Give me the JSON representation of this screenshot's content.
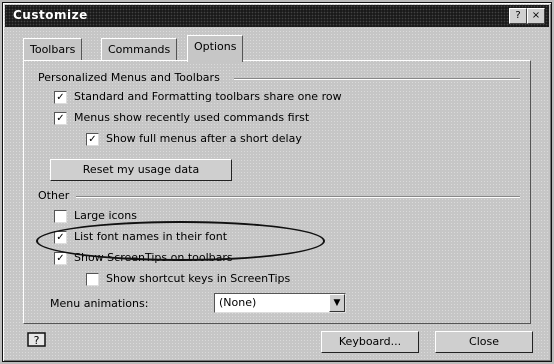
{
  "window": {
    "title": "Customize",
    "help_button": "?",
    "close_button": "×"
  },
  "tabs": [
    {
      "label": "Toolbars"
    },
    {
      "label": "Commands"
    },
    {
      "label": "Options"
    }
  ],
  "personalized": {
    "heading": "Personalized Menus and Toolbars",
    "standard_formatting": {
      "label": "Standard and Formatting toolbars share one row",
      "checked": "✓"
    },
    "recent_commands": {
      "label": "Menus show recently used commands first",
      "checked": "✓"
    },
    "full_menus_delay": {
      "label": "Show full menus after a short delay",
      "checked": "✓"
    },
    "reset_button": "Reset my usage data"
  },
  "other": {
    "heading": "Other",
    "large_icons": {
      "label": "Large icons",
      "checked": ""
    },
    "font_names": {
      "label": "List font names in their font",
      "checked": "✓"
    },
    "screentips": {
      "label": "Show ScreenTips on toolbars",
      "checked": "✓"
    },
    "shortcut_keys": {
      "label": "Show shortcut keys in ScreenTips",
      "checked": ""
    },
    "menu_animations_label": "Menu animations:",
    "menu_animations_value": "(None)"
  },
  "footer": {
    "help_icon": "help-icon",
    "keyboard_button": "Keyboard...",
    "close_button": "Close"
  }
}
